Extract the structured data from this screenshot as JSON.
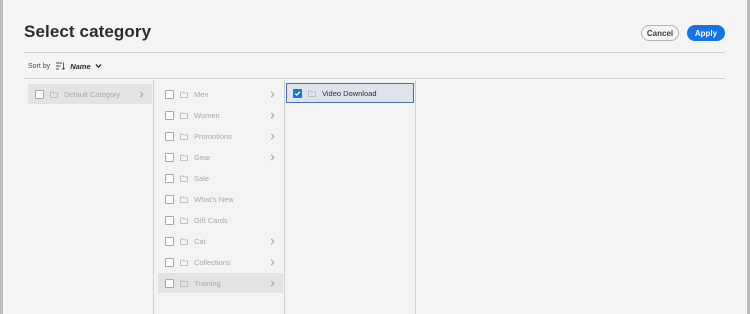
{
  "dialog": {
    "title": "Select category",
    "cancel_label": "Cancel",
    "apply_label": "Apply",
    "accent_color": "#1473e6"
  },
  "sort": {
    "label": "Sort by",
    "value": "Name",
    "icon": "sort-lines-icon"
  },
  "columns": [
    {
      "items": [
        {
          "label": "Default Category",
          "has_children": true,
          "checked": false,
          "highlighted": true
        }
      ]
    },
    {
      "items": [
        {
          "label": "Men",
          "has_children": true,
          "checked": false
        },
        {
          "label": "Women",
          "has_children": true,
          "checked": false
        },
        {
          "label": "Promotions",
          "has_children": true,
          "checked": false
        },
        {
          "label": "Gear",
          "has_children": true,
          "checked": false
        },
        {
          "label": "Sale",
          "has_children": false,
          "checked": false
        },
        {
          "label": "What's New",
          "has_children": false,
          "checked": false
        },
        {
          "label": "Gift Cards",
          "has_children": false,
          "checked": false
        },
        {
          "label": "Cat",
          "has_children": true,
          "checked": false
        },
        {
          "label": "Collections",
          "has_children": true,
          "checked": false
        },
        {
          "label": "Training",
          "has_children": true,
          "checked": false,
          "highlighted": true
        }
      ]
    },
    {
      "items": [
        {
          "label": "Video Download",
          "has_children": false,
          "checked": true,
          "selected": true
        }
      ]
    }
  ]
}
